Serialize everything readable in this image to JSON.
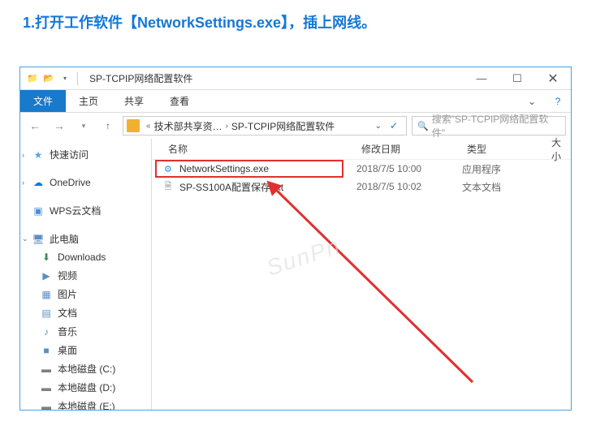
{
  "step_title": "1.打开工作软件【NetworkSettings.exe】，插上网线。",
  "window": {
    "title": "SP-TCPIP网络配置软件"
  },
  "ribbon": {
    "file": "文件",
    "home": "主页",
    "share": "共享",
    "view": "查看"
  },
  "breadcrumb": {
    "seg1": "技术部共享资…",
    "seg2": "SP-TCPIP网络配置软件"
  },
  "search": {
    "placeholder": "搜索\"SP-TCPIP网络配置软件\""
  },
  "sidebar": {
    "quick": "快速访问",
    "onedrive": "OneDrive",
    "wps": "WPS云文档",
    "thispc": "此电脑",
    "downloads": "Downloads",
    "videos": "视频",
    "pictures": "图片",
    "docs": "文档",
    "music": "音乐",
    "desktop": "桌面",
    "drive_c": "本地磁盘 (C:)",
    "drive_d": "本地磁盘 (D:)",
    "drive_e": "本地磁盘 (E:)"
  },
  "columns": {
    "name": "名称",
    "date": "修改日期",
    "type": "类型",
    "size": "大小"
  },
  "files": [
    {
      "name": "NetworkSettings.exe",
      "date": "2018/7/5 10:00",
      "type": "应用程序",
      "kind": "exe"
    },
    {
      "name": "SP-SS100A配置保存.txt",
      "date": "2018/7/5 10:02",
      "type": "文本文档",
      "kind": "txt"
    }
  ],
  "watermark": "SunPn"
}
